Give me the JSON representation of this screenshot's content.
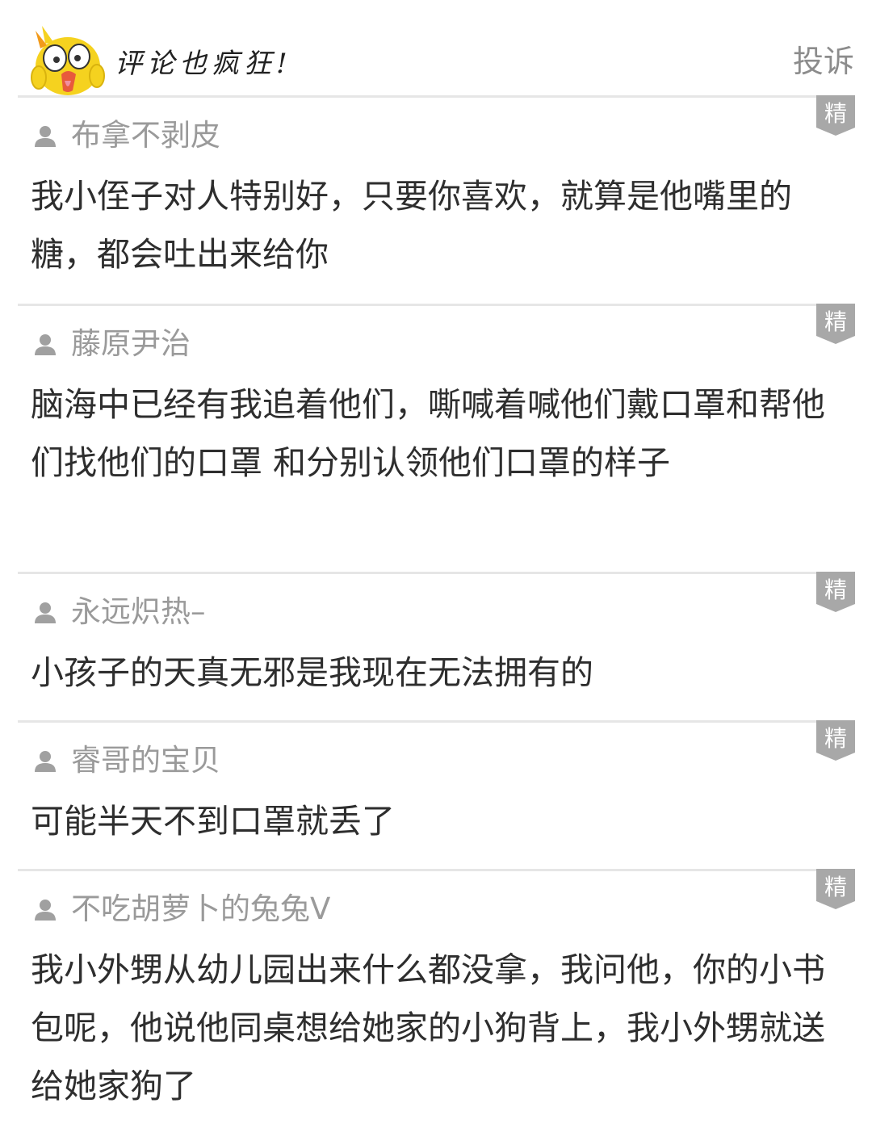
{
  "header": {
    "title": "评论也疯狂!",
    "report_label": "投诉",
    "mascot_icon": "chick-mascot-icon"
  },
  "badge_label": "精",
  "colors": {
    "username": "#9a9a9a",
    "divider": "#e6e6e6",
    "badge": "#a8a8a8",
    "mascot": "#f5d21f"
  },
  "comments": [
    {
      "user": "布拿不剥皮",
      "text": "我小侄子对人特别好，只要你喜欢，就算是他嘴里的糖，都会吐出来给你"
    },
    {
      "user": "藤原尹治",
      "text": "脑海中已经有我追着他们，嘶喊着喊他们戴口罩和帮他们找他们的口罩 和分别认领他们口罩的样子"
    },
    {
      "user": "永远炽热–",
      "text": "小孩子的天真无邪是我现在无法拥有的"
    },
    {
      "user": "睿哥的宝贝",
      "text": "可能半天不到口罩就丢了"
    },
    {
      "user": "不吃胡萝卜的兔兔V",
      "text": "我小外甥从幼儿园出来什么都没拿，我问他，你的小书包呢，他说他同桌想给她家的小狗背上，我小外甥就送给她家狗了"
    }
  ]
}
